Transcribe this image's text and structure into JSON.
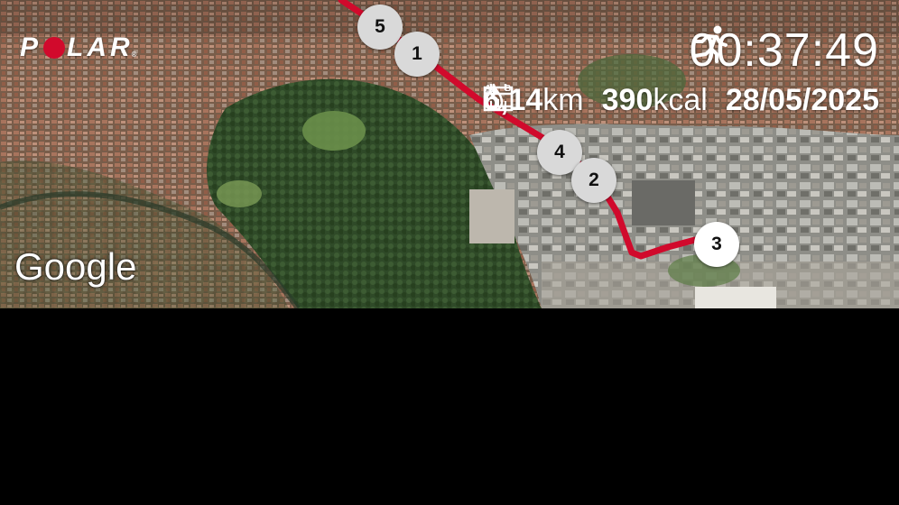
{
  "brand": {
    "logo_text_1": "P",
    "logo_text_2": "LAR",
    "registered": "®",
    "accent_color": "#d10a2c"
  },
  "workout": {
    "activity_icon": "running-person-icon",
    "duration": "00:37:49",
    "distance_value": "6,14",
    "distance_unit": "km",
    "distance_icon": "distance-ab-icon",
    "calories_value": "390",
    "calories_unit": "kcal",
    "calories_icon": "flame-icon",
    "date": "28/05/2025",
    "date_icon": "calendar-icon"
  },
  "map": {
    "attribution": "Google",
    "route_color": "#d10a2c",
    "lap_markers": [
      "5",
      "1",
      "4",
      "2",
      "3"
    ]
  }
}
